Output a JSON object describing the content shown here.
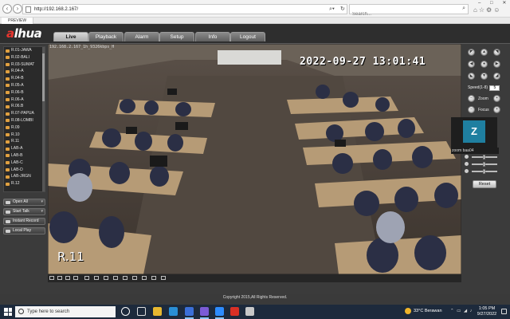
{
  "browser": {
    "url": "http://192.168.2.167/",
    "search_placeholder": "Search...",
    "tab_title": "PREVIEW"
  },
  "app": {
    "logo_prefix": "a",
    "logo_rest": "lhua",
    "tabs": [
      "Live",
      "Playback",
      "Alarm",
      "Setup",
      "Info",
      "Logout"
    ],
    "active_tab": "Live"
  },
  "channels": [
    "R.01-JAWA",
    "R.02-BALI",
    "R.03-SUMAT",
    "R.04-A",
    "R.04-B",
    "R.05-A",
    "R.06-B",
    "R.06-A",
    "R.06.B",
    "R.07-PAPUA",
    "R.08-LOMBI",
    "R.09",
    "R.10",
    "R.11",
    "LAB-A",
    "LAB-B",
    "LAB-C",
    "LAB-D",
    "LAB-JRGN",
    "R.12"
  ],
  "side_buttons": {
    "open_all": "Open All",
    "start_talk": "Start Talk",
    "instant_record": "Instant Record",
    "local_play": "Local Play"
  },
  "video": {
    "info": "192.168.2.167_1h_9326kbps_H",
    "timestamp": "2022-09-27 13:01:41",
    "channel_label": "R.11"
  },
  "ptz": {
    "speed_label": "Speed(1-8)",
    "speed_value": "5",
    "zoom_label": "Zoom",
    "focus_label": "Focus",
    "reset_label": "Reset"
  },
  "zoom_overlay": {
    "initial": "Z",
    "name": "zoom baa04"
  },
  "footer": {
    "copyright": "Copyright 2015,All Rights Reserved."
  },
  "taskbar": {
    "search_placeholder": "Type here to search",
    "weather": "33°C  Berawan",
    "time": "1:05 PM",
    "date": "9/27/2022"
  },
  "colors": {
    "accent_logo": "#e8352e",
    "zoom_tile": "#1f7fa0",
    "taskbar": "#1d2a3c"
  }
}
